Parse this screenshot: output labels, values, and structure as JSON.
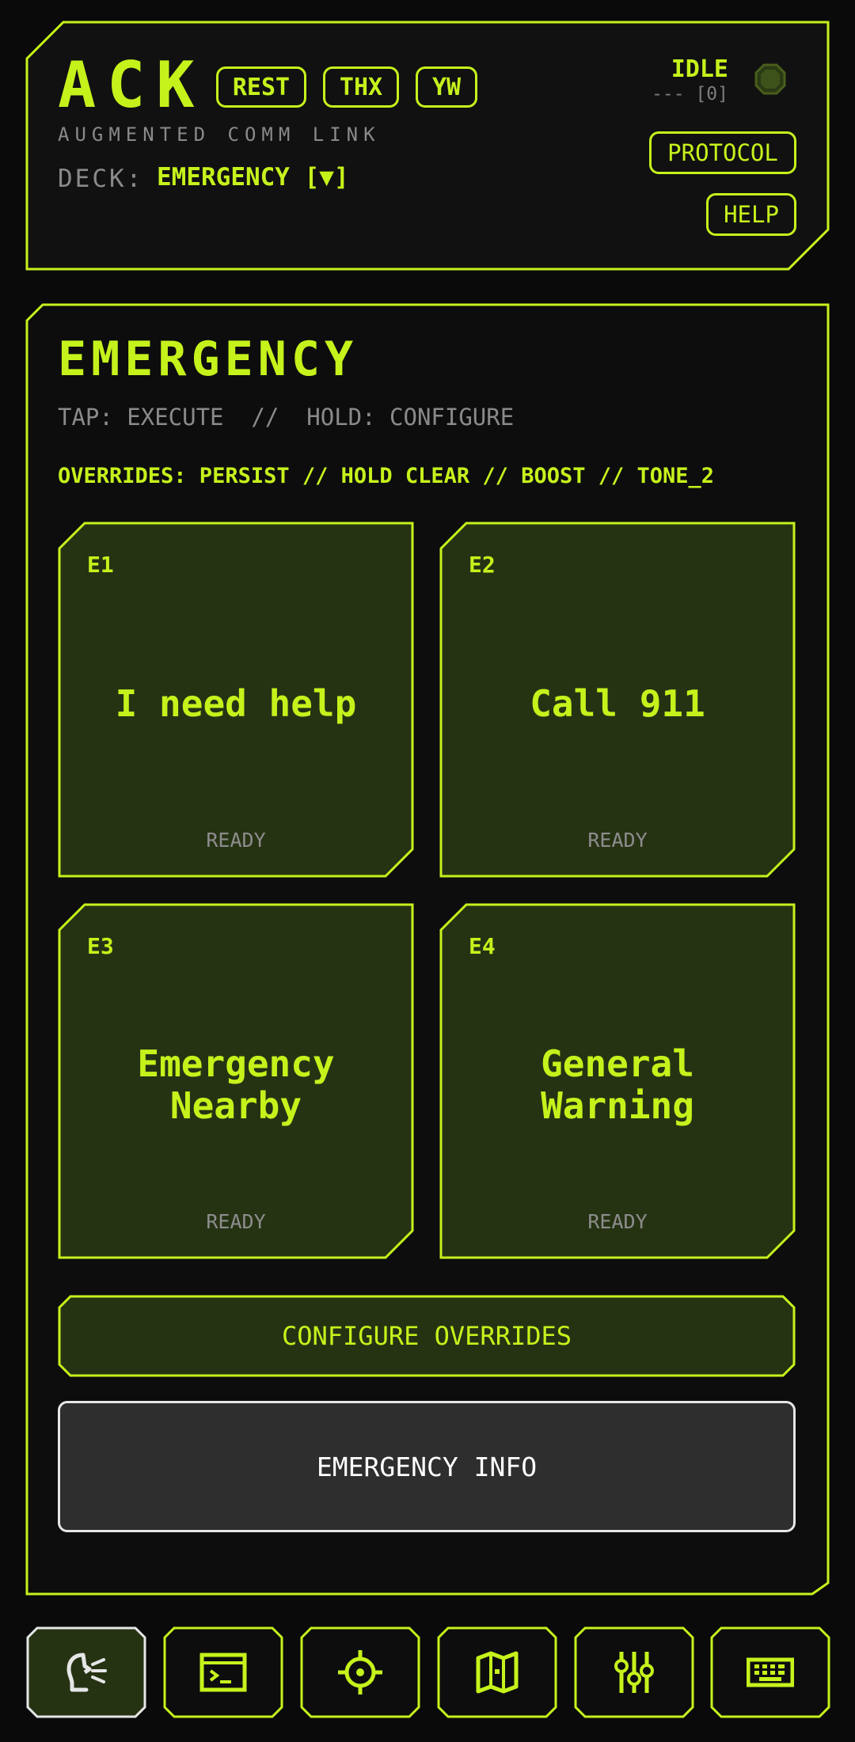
{
  "colors": {
    "accent": "#c6f21c",
    "tile_bg": "#263313",
    "muted": "#8a8a8a",
    "info_bg": "#2e2e2e"
  },
  "header": {
    "brand": "ACK",
    "quick_buttons": [
      {
        "label": "REST"
      },
      {
        "label": "THX"
      },
      {
        "label": "YW"
      }
    ],
    "subtitle": "AUGMENTED COMM LINK",
    "deck_label": "DECK:",
    "deck_value": "EMERGENCY [▼]",
    "status": "IDLE",
    "counter": "--- [0]",
    "protocol_label": "PROTOCOL",
    "help_label": "HELP"
  },
  "panel": {
    "title": "EMERGENCY",
    "hint": "TAP: EXECUTE  //  HOLD: CONFIGURE",
    "overrides": "OVERRIDES: PERSIST // HOLD CLEAR // BOOST // TONE_2",
    "tiles": [
      {
        "code": "E1",
        "phrase": "I need help",
        "status": "READY"
      },
      {
        "code": "E2",
        "phrase": "Call 911",
        "status": "READY"
      },
      {
        "code": "E3",
        "phrase": "Emergency Nearby",
        "status": "READY"
      },
      {
        "code": "E4",
        "phrase": "General Warning",
        "status": "READY"
      }
    ],
    "configure_label": "CONFIGURE OVERRIDES",
    "info_label": "EMERGENCY INFO"
  },
  "nav": [
    {
      "icon": "speak-icon",
      "active": true
    },
    {
      "icon": "terminal-icon",
      "active": false
    },
    {
      "icon": "crosshair-icon",
      "active": false
    },
    {
      "icon": "map-icon",
      "active": false
    },
    {
      "icon": "sliders-icon",
      "active": false
    },
    {
      "icon": "keyboard-icon",
      "active": false
    }
  ]
}
